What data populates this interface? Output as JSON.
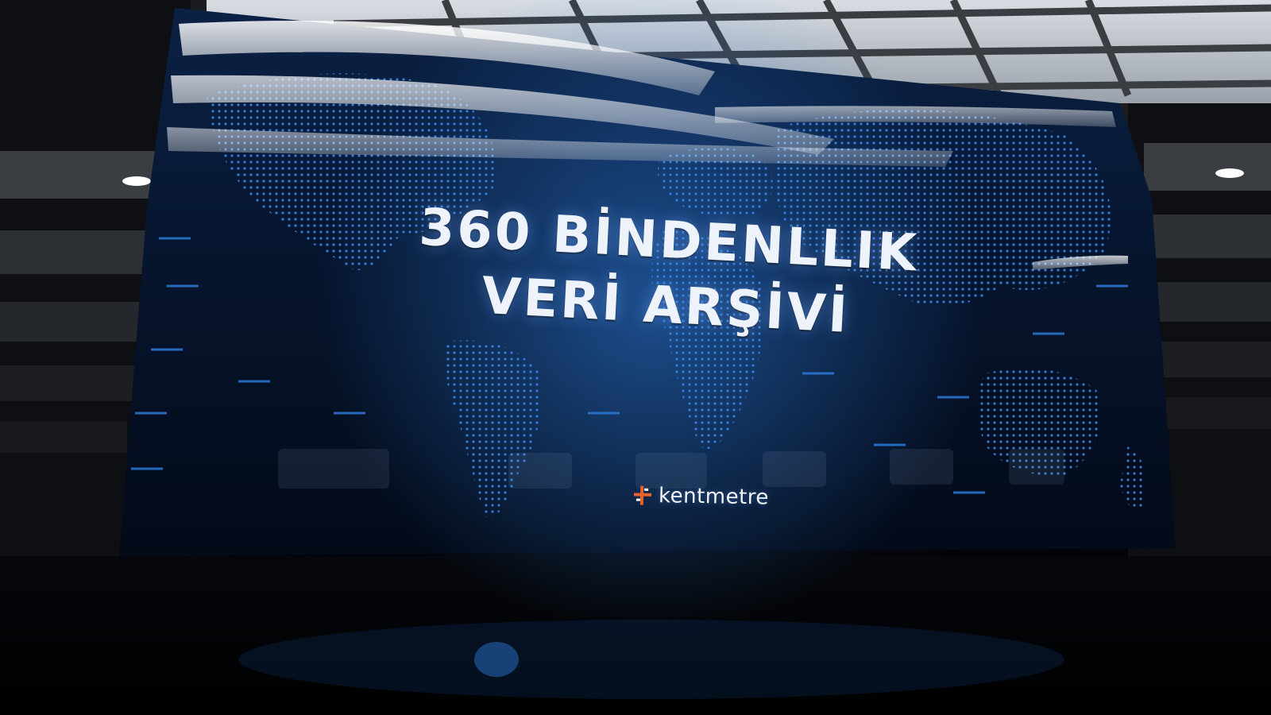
{
  "screen": {
    "title_line_1": "360 BİNDENLLIK",
    "title_line_2": "VERİ ARŞİVİ"
  },
  "brand": {
    "name": "kentmetre",
    "mark_icon": "kentmetre-logo-icon",
    "mark_colors": [
      "#e8632b",
      "#ffffff"
    ]
  },
  "scene": {
    "description_icons": [
      "ceiling-light-grid",
      "world-map-display",
      "reflective-floor"
    ],
    "accent_color": "#2f7fe0",
    "map_dot_color": "#3d8cf0"
  }
}
